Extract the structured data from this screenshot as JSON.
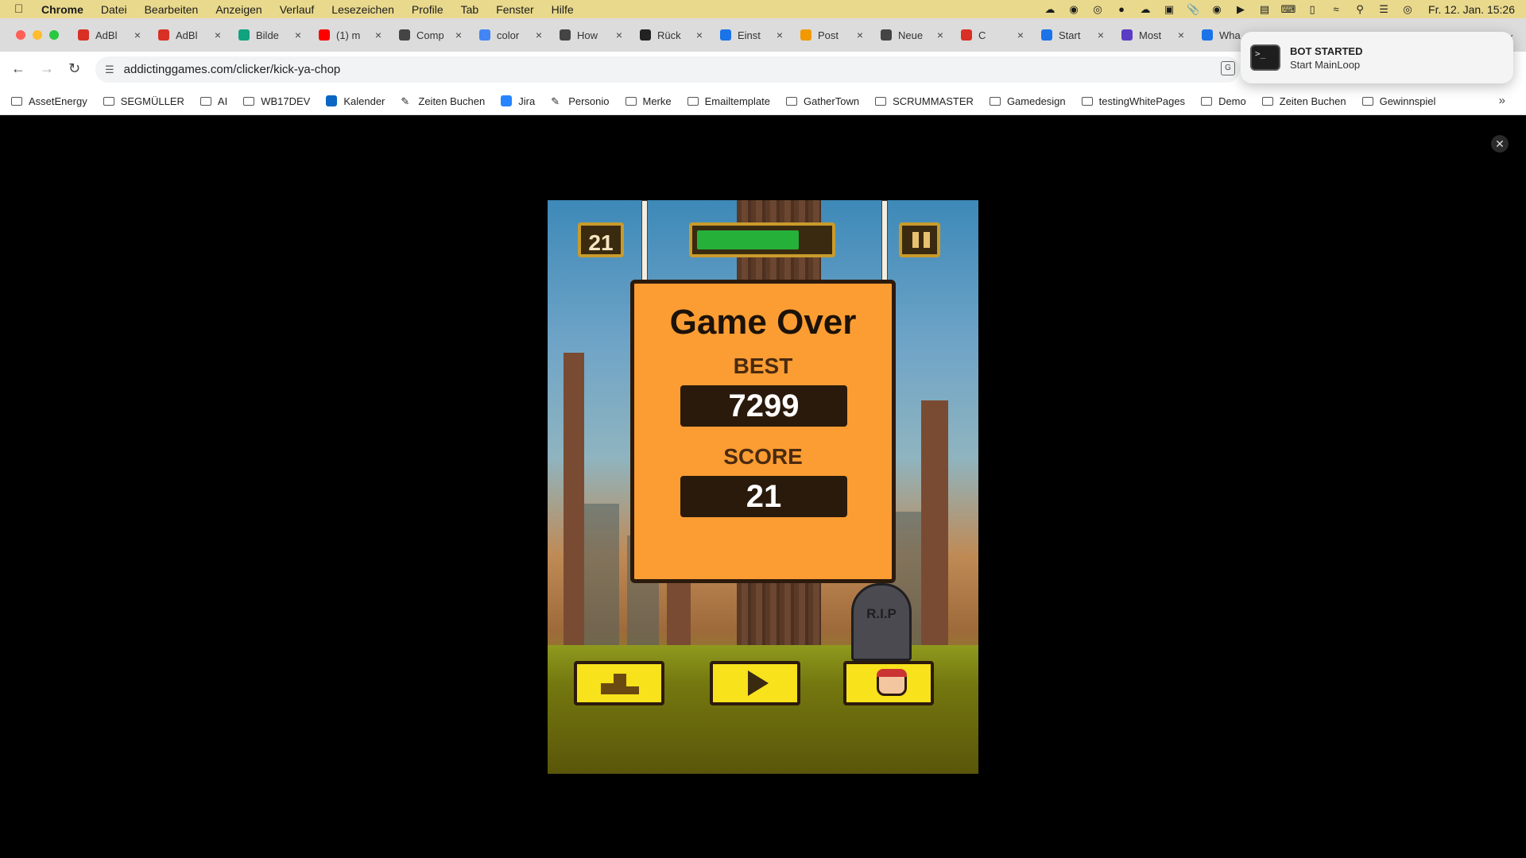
{
  "menubar": {
    "app": "Chrome",
    "items": [
      "Datei",
      "Bearbeiten",
      "Anzeigen",
      "Verlauf",
      "Lesezeichen",
      "Profile",
      "Tab",
      "Fenster",
      "Hilfe"
    ],
    "clock": "Fr. 12. Jan. 15:26"
  },
  "tabs": [
    {
      "label": "AdBl",
      "icon": "adblock-icon",
      "color": "#d93025"
    },
    {
      "label": "AdBl",
      "icon": "opera-icon",
      "color": "#d93025"
    },
    {
      "label": "Bilde",
      "icon": "openai-icon",
      "color": "#10a37f"
    },
    {
      "label": "(1) m",
      "icon": "youtube-icon",
      "color": "#ff0000"
    },
    {
      "label": "Comp",
      "icon": "github-icon",
      "color": "#444444"
    },
    {
      "label": "color",
      "icon": "google-icon",
      "color": "#4285f4"
    },
    {
      "label": "How",
      "icon": "github-icon",
      "color": "#444444"
    },
    {
      "label": "Rück",
      "icon": "amazon-icon",
      "color": "#222222"
    },
    {
      "label": "Einst",
      "icon": "settings-icon",
      "color": "#1a73e8"
    },
    {
      "label": "Post",
      "icon": "mail-icon",
      "color": "#f29900"
    },
    {
      "label": "Neue",
      "icon": "github-icon",
      "color": "#444444"
    },
    {
      "label": "C",
      "icon": "app-icon",
      "color": "#d93025"
    },
    {
      "label": "Start",
      "icon": "chrome-icon",
      "color": "#1a73e8"
    },
    {
      "label": "Most",
      "icon": "shield-icon",
      "color": "#5b3cc4"
    },
    {
      "label": "Wha",
      "icon": "app-icon",
      "color": "#1a73e8"
    }
  ],
  "address": {
    "url": "addictinggames.com/clicker/kick-ya-chop"
  },
  "bookmarks": [
    {
      "label": "AssetEnergy",
      "type": "folder"
    },
    {
      "label": "SEGMÜLLER",
      "type": "folder"
    },
    {
      "label": "AI",
      "type": "folder"
    },
    {
      "label": "WB17DEV",
      "type": "folder"
    },
    {
      "label": "Kalender",
      "type": "app",
      "color": "#0a66c2"
    },
    {
      "label": "Zeiten Buchen",
      "type": "link"
    },
    {
      "label": "Jira",
      "type": "app",
      "color": "#2684ff"
    },
    {
      "label": "Personio",
      "type": "link"
    },
    {
      "label": "Merke",
      "type": "folder"
    },
    {
      "label": "Emailtemplate",
      "type": "folder"
    },
    {
      "label": "GatherTown",
      "type": "folder"
    },
    {
      "label": "SCRUMMASTER",
      "type": "folder"
    },
    {
      "label": "Gamedesign",
      "type": "folder"
    },
    {
      "label": "testingWhitePages",
      "type": "folder"
    },
    {
      "label": "Demo",
      "type": "folder"
    },
    {
      "label": "Zeiten Buchen",
      "type": "folder"
    },
    {
      "label": "Gewinnspiel",
      "type": "folder"
    }
  ],
  "notification": {
    "title": "BOT STARTED",
    "body": "Start MainLoop"
  },
  "game": {
    "hud_score": "21",
    "timer_fill": 0.78,
    "game_over_title": "Game Over",
    "best_label": "BEST",
    "best_value": "7299",
    "score_label": "SCORE",
    "score_value": "21",
    "tombstone": "R.I.P",
    "colors": {
      "sign": "#fb9d33",
      "button": "#f7e21c",
      "timer": "#25b03a"
    }
  }
}
